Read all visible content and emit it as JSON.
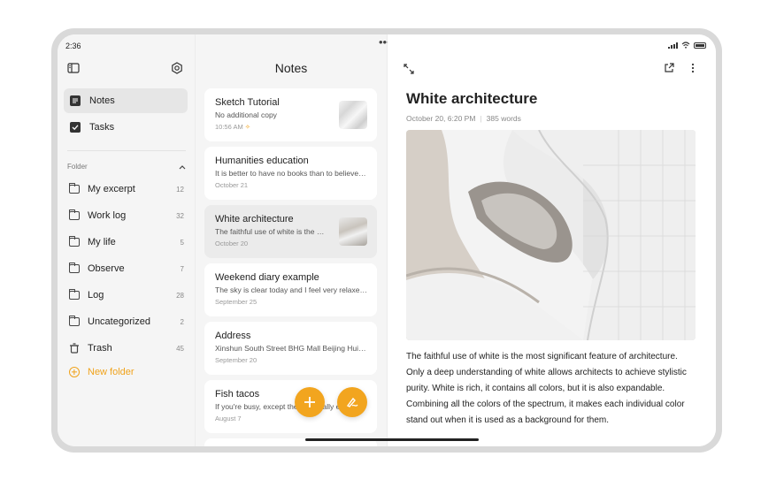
{
  "status": {
    "time": "2:36"
  },
  "sidebar": {
    "nav": [
      {
        "label": "Notes",
        "icon": "notes-icon",
        "active": true
      },
      {
        "label": "Tasks",
        "icon": "checkbox-icon",
        "active": false
      }
    ],
    "folder_header": "Folder",
    "folders": [
      {
        "label": "My excerpt",
        "count": "12"
      },
      {
        "label": "Work log",
        "count": "32"
      },
      {
        "label": "My life",
        "count": "5"
      },
      {
        "label": "Observe",
        "count": "7"
      },
      {
        "label": "Log",
        "count": "28"
      },
      {
        "label": "Uncategorized",
        "count": "2"
      },
      {
        "label": "Trash",
        "count": "45"
      }
    ],
    "new_folder_label": "New folder"
  },
  "notes": {
    "title": "Notes",
    "cards": [
      {
        "title": "Sketch Tutorial",
        "snippet": "No additional copy",
        "date": "10:56 AM",
        "thumb": "silk"
      },
      {
        "title": "Humanities education",
        "snippet": "It is better to have no books than to believe all of books",
        "date": "October 21"
      },
      {
        "title": "White architecture",
        "snippet": "The faithful use of white is the most significant",
        "date": "October 20",
        "thumb": "arch",
        "active": true
      },
      {
        "title": "Weekend diary example",
        "snippet": "The sky is clear today and I feel very relaxed and happy",
        "date": "September 25"
      },
      {
        "title": "Address",
        "snippet": "Xinshun South Street BHG Mall Beijing Huilongguan",
        "date": "September 20"
      },
      {
        "title": "Fish tacos",
        "snippet": "If you're busy, except the fish, really easy",
        "date": "August 7"
      }
    ]
  },
  "detail": {
    "title": "White architecture",
    "date": "October 20, 6:20 PM",
    "words": "385 words",
    "body": "The faithful use of white is the most significant feature of architecture. Only a deep understanding of white allows architects to achieve stylistic purity. White is rich, it contains all colors, but it is also expandable. Combining all the colors of the spectrum, it makes each individual color stand out when it is used as a background for them."
  },
  "colors": {
    "accent": "#f2a51f",
    "sidebar_bg": "#f5f5f5"
  }
}
